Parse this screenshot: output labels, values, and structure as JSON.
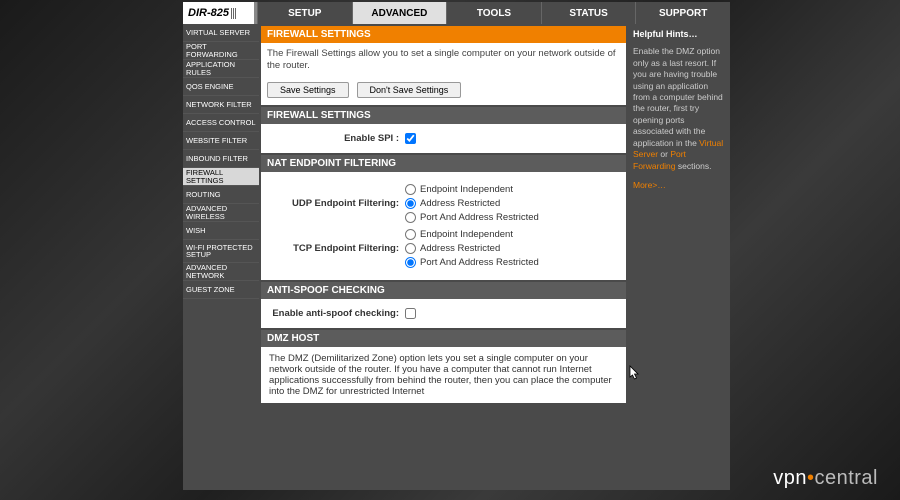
{
  "device_name": "DIR-825",
  "topnav": {
    "tabs": [
      "SETUP",
      "ADVANCED",
      "TOOLS",
      "STATUS",
      "SUPPORT"
    ],
    "active": 1
  },
  "sidebar": {
    "items": [
      "VIRTUAL SERVER",
      "PORT FORWARDING",
      "APPLICATION RULES",
      "QOS ENGINE",
      "NETWORK FILTER",
      "ACCESS CONTROL",
      "WEBSITE FILTER",
      "INBOUND FILTER",
      "FIREWALL SETTINGS",
      "ROUTING",
      "ADVANCED WIRELESS",
      "WISH",
      "WI-FI PROTECTED SETUP",
      "ADVANCED NETWORK",
      "GUEST ZONE"
    ],
    "active": 8
  },
  "hero": {
    "title": "FIREWALL SETTINGS",
    "desc": "The Firewall Settings allow you to set a single computer on your network outside of the router.",
    "save_label": "Save Settings",
    "dont_save_label": "Don't Save Settings"
  },
  "firewall": {
    "title": "FIREWALL SETTINGS",
    "enable_spi_label": "Enable SPI :",
    "enable_spi_checked": true
  },
  "nat": {
    "title": "NAT ENDPOINT FILTERING",
    "udp_label": "UDP Endpoint Filtering:",
    "tcp_label": "TCP Endpoint Filtering:",
    "opt_independent": "Endpoint Independent",
    "opt_address": "Address Restricted",
    "opt_port_address": "Port And Address Restricted",
    "udp_selected": "address",
    "tcp_selected": "port_address"
  },
  "antispoof": {
    "title": "ANTI-SPOOF CHECKING",
    "label": "Enable anti-spoof checking:",
    "checked": false
  },
  "dmz": {
    "title": "DMZ HOST",
    "desc": "The DMZ (Demilitarized Zone) option lets you set a single computer on your network outside of the router. If you have a computer that cannot run Internet applications successfully from behind the router, then you can place the computer into the DMZ for unrestricted Internet"
  },
  "help": {
    "title": "Helpful Hints…",
    "p1a": "Enable the DMZ option only as a last resort. If you are having trouble using an application from a computer behind the router, first try opening ports associated with the application in the ",
    "link1": "Virtual Server",
    "p1b": " or ",
    "link2": "Port Forwarding",
    "p1c": " sections.",
    "more": "More>…"
  },
  "watermark": {
    "a": "vpn",
    "b": "central"
  },
  "colors": {
    "accent": "#f08000",
    "panel_header": "#5c5c5c",
    "chrome": "#4a4a4a"
  }
}
